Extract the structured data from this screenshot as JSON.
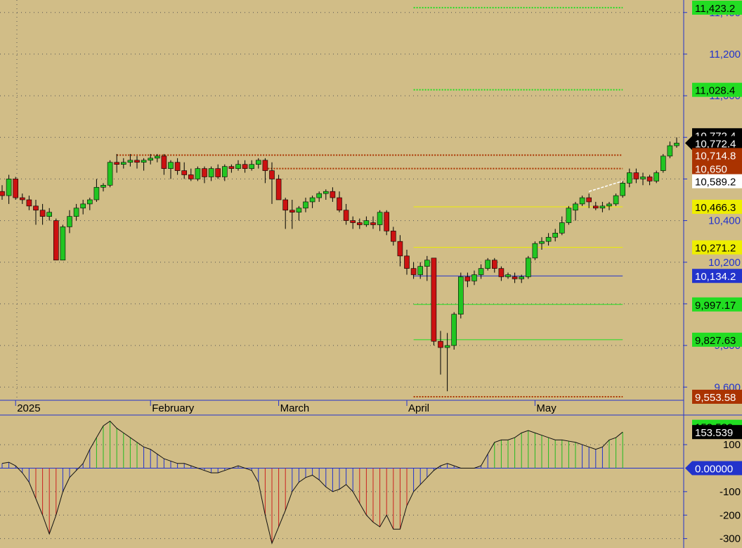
{
  "colors": {
    "background": "#d1bd87",
    "up": "#22c522",
    "down": "#cc1111",
    "grid": "#555555",
    "axis": "#2233cc",
    "axis_text": "#2233cc",
    "osc_line": "#111111",
    "osc_pos": "#22bb22",
    "osc_neg": "#cc2222",
    "osc_mid": "#2233cc"
  },
  "chart_data": [
    {
      "type": "candlestick",
      "name": "price",
      "ylim": [
        9540,
        11460
      ],
      "y_ticks": [
        {
          "value": 9600,
          "label": "9,600"
        },
        {
          "value": 9800,
          "label": "9,800"
        },
        {
          "value": 10000,
          "label": "10,000"
        },
        {
          "value": 10200,
          "label": "10,200"
        },
        {
          "value": 10400,
          "label": "10,400"
        },
        {
          "value": 10600,
          "label": "10,600"
        },
        {
          "value": 10800,
          "label": "10,800"
        },
        {
          "value": 11000,
          "label": "11,000"
        },
        {
          "value": 11200,
          "label": "11,200"
        },
        {
          "value": 11400,
          "label": "11,400"
        }
      ],
      "x_labels": [
        {
          "index": 2,
          "label": "2025"
        },
        {
          "index": 22,
          "label": "February"
        },
        {
          "index": 41,
          "label": "March"
        },
        {
          "index": 60,
          "label": "April"
        },
        {
          "index": 79,
          "label": "May"
        }
      ],
      "candles": [
        [
          10540,
          10570,
          10500,
          10520
        ],
        [
          10520,
          10620,
          10480,
          10600
        ],
        [
          10600,
          10610,
          10500,
          10510
        ],
        [
          10510,
          10530,
          10480,
          10500
        ],
        [
          10500,
          10520,
          10450,
          10470
        ],
        [
          10470,
          10500,
          10380,
          10450
        ],
        [
          10450,
          10480,
          10380,
          10420
        ],
        [
          10420,
          10460,
          10400,
          10440
        ],
        [
          10400,
          10410,
          10210,
          10210
        ],
        [
          10210,
          10380,
          10210,
          10370
        ],
        [
          10370,
          10450,
          10340,
          10420
        ],
        [
          10420,
          10480,
          10400,
          10460
        ],
        [
          10460,
          10500,
          10430,
          10480
        ],
        [
          10480,
          10510,
          10450,
          10500
        ],
        [
          10500,
          10600,
          10490,
          10560
        ],
        [
          10560,
          10580,
          10540,
          10570
        ],
        [
          10570,
          10690,
          10560,
          10680
        ],
        [
          10680,
          10720,
          10630,
          10670
        ],
        [
          10670,
          10700,
          10650,
          10680
        ],
        [
          10680,
          10720,
          10660,
          10690
        ],
        [
          10690,
          10710,
          10650,
          10680
        ],
        [
          10680,
          10700,
          10640,
          10690
        ],
        [
          10690,
          10720,
          10670,
          10700
        ],
        [
          10700,
          10720,
          10680,
          10710
        ],
        [
          10710,
          10720,
          10620,
          10650
        ],
        [
          10650,
          10690,
          10600,
          10680
        ],
        [
          10680,
          10700,
          10620,
          10640
        ],
        [
          10640,
          10680,
          10600,
          10620
        ],
        [
          10620,
          10650,
          10590,
          10600
        ],
        [
          10600,
          10660,
          10590,
          10650
        ],
        [
          10650,
          10660,
          10580,
          10610
        ],
        [
          10610,
          10660,
          10590,
          10650
        ],
        [
          10650,
          10670,
          10600,
          10610
        ],
        [
          10610,
          10670,
          10590,
          10660
        ],
        [
          10660,
          10670,
          10630,
          10650
        ],
        [
          10650,
          10690,
          10640,
          10670
        ],
        [
          10670,
          10690,
          10630,
          10650
        ],
        [
          10650,
          10690,
          10640,
          10670
        ],
        [
          10670,
          10700,
          10650,
          10690
        ],
        [
          10690,
          10700,
          10580,
          10640
        ],
        [
          10640,
          10680,
          10480,
          10600
        ],
        [
          10600,
          10620,
          10500,
          10500
        ],
        [
          10500,
          10510,
          10360,
          10450
        ],
        [
          10450,
          10500,
          10360,
          10440
        ],
        [
          10440,
          10470,
          10400,
          10460
        ],
        [
          10460,
          10510,
          10440,
          10490
        ],
        [
          10490,
          10520,
          10460,
          10510
        ],
        [
          10510,
          10540,
          10490,
          10530
        ],
        [
          10530,
          10550,
          10500,
          10540
        ],
        [
          10540,
          10560,
          10490,
          10510
        ],
        [
          10510,
          10540,
          10440,
          10450
        ],
        [
          10450,
          10480,
          10380,
          10400
        ],
        [
          10400,
          10420,
          10360,
          10390
        ],
        [
          10390,
          10410,
          10360,
          10380
        ],
        [
          10380,
          10420,
          10370,
          10400
        ],
        [
          10390,
          10420,
          10360,
          10380
        ],
        [
          10380,
          10450,
          10350,
          10440
        ],
        [
          10440,
          10450,
          10330,
          10350
        ],
        [
          10350,
          10370,
          10280,
          10300
        ],
        [
          10300,
          10330,
          10180,
          10230
        ],
        [
          10230,
          10260,
          10140,
          10170
        ],
        [
          10170,
          10200,
          10120,
          10140
        ],
        [
          10140,
          10200,
          10120,
          10180
        ],
        [
          10180,
          10230,
          10110,
          10210
        ],
        [
          10220,
          10220,
          9800,
          9820
        ],
        [
          9820,
          9870,
          9660,
          9790
        ],
        [
          9790,
          9860,
          9580,
          9800
        ],
        [
          9800,
          9960,
          9780,
          9950
        ],
        [
          9950,
          10150,
          9930,
          10130
        ],
        [
          10130,
          10150,
          10080,
          10110
        ],
        [
          10110,
          10160,
          10090,
          10140
        ],
        [
          10140,
          10190,
          10120,
          10170
        ],
        [
          10170,
          10220,
          10160,
          10210
        ],
        [
          10210,
          10220,
          10150,
          10170
        ],
        [
          10170,
          10180,
          10110,
          10130
        ],
        [
          10130,
          10150,
          10120,
          10140
        ],
        [
          10130,
          10150,
          10100,
          10120
        ],
        [
          10120,
          10140,
          10100,
          10130
        ],
        [
          10130,
          10230,
          10120,
          10220
        ],
        [
          10220,
          10300,
          10210,
          10290
        ],
        [
          10290,
          10320,
          10260,
          10300
        ],
        [
          10300,
          10340,
          10280,
          10320
        ],
        [
          10320,
          10360,
          10300,
          10340
        ],
        [
          10340,
          10420,
          10330,
          10390
        ],
        [
          10390,
          10470,
          10380,
          10460
        ],
        [
          10450,
          10490,
          10400,
          10480
        ],
        [
          10480,
          10520,
          10470,
          10510
        ],
        [
          10510,
          10530,
          10460,
          10490
        ],
        [
          10470,
          10490,
          10450,
          10460
        ],
        [
          10460,
          10490,
          10440,
          10470
        ],
        [
          10470,
          10490,
          10450,
          10480
        ],
        [
          10480,
          10530,
          10470,
          10520
        ],
        [
          10520,
          10590,
          10510,
          10580
        ],
        [
          10580,
          10650,
          10560,
          10630
        ],
        [
          10630,
          10650,
          10580,
          10600
        ],
        [
          10600,
          10630,
          10570,
          10610
        ],
        [
          10610,
          10620,
          10570,
          10590
        ],
        [
          10590,
          10640,
          10580,
          10630
        ],
        [
          10640,
          10720,
          10630,
          10710
        ],
        [
          10710,
          10780,
          10700,
          10760
        ],
        [
          10760,
          10800,
          10750,
          10772.4
        ]
      ],
      "levels": [
        {
          "value": 11423.2,
          "color": "#22dd22",
          "style": "dotted",
          "from": 61,
          "to": 92
        },
        {
          "value": 11028.4,
          "color": "#22dd22",
          "style": "dotted",
          "from": 61,
          "to": 92
        },
        {
          "value": 10714.8,
          "color": "#aa3300",
          "style": "dotted",
          "from": 17,
          "to": 92
        },
        {
          "value": 10650,
          "color": "#aa3300",
          "style": "dotted",
          "from": 39,
          "to": 92
        },
        {
          "value": 10466.3,
          "color": "#eeee00",
          "style": "solid",
          "from": 61,
          "to": 92
        },
        {
          "value": 10271.2,
          "color": "#eeee00",
          "style": "solid",
          "from": 61,
          "to": 92
        },
        {
          "value": 10134.2,
          "color": "#2233cc",
          "style": "solid",
          "from": 61,
          "to": 92
        },
        {
          "value": 9997.17,
          "color": "#22dd22",
          "style": "solid",
          "from": 61,
          "to": 92
        },
        {
          "value": 9827.63,
          "color": "#22dd22",
          "style": "solid",
          "from": 61,
          "to": 92
        },
        {
          "value": 9553.58,
          "color": "#aa3300",
          "style": "dotted",
          "from": 61,
          "to": 92
        }
      ],
      "trendline": {
        "from": [
          87,
          10540
        ],
        "to": [
          92,
          10590
        ],
        "color": "#ffffff"
      },
      "price_labels": [
        {
          "value": 11423.2,
          "text": "11,423.2",
          "bg": "#22dd22",
          "fg": "#000000"
        },
        {
          "value": 11028.4,
          "text": "11,028.4",
          "bg": "#22dd22",
          "fg": "#000000"
        },
        {
          "value": 10810,
          "text": "10,772.4",
          "bg": "#000000",
          "fg": "#ffffff"
        },
        {
          "value": 10772.4,
          "text": "10,772.4",
          "bg": "#000000",
          "fg": "#ffffff",
          "pointer": true
        },
        {
          "value": 10714.8,
          "text": "10,714.8",
          "bg": "#aa3300",
          "fg": "#ffffff"
        },
        {
          "value": 10650,
          "text": "10,650",
          "bg": "#aa3300",
          "fg": "#ffffff"
        },
        {
          "value": 10589.2,
          "text": "10,589.2",
          "bg": "#ffffff",
          "fg": "#000000"
        },
        {
          "value": 10466.3,
          "text": "10,466.3",
          "bg": "#eeee00",
          "fg": "#000000"
        },
        {
          "value": 10271.2,
          "text": "10,271.2",
          "bg": "#eeee00",
          "fg": "#000000"
        },
        {
          "value": 10134.2,
          "text": "10,134.2",
          "bg": "#2233cc",
          "fg": "#ffffff"
        },
        {
          "value": 9997.17,
          "text": "9,997.17",
          "bg": "#22dd22",
          "fg": "#000000"
        },
        {
          "value": 9827.63,
          "text": "9,827.63",
          "bg": "#22dd22",
          "fg": "#000000"
        },
        {
          "value": 9553.58,
          "text": "9,553.58",
          "bg": "#aa3300",
          "fg": "#ffffff"
        }
      ]
    },
    {
      "type": "histogram",
      "name": "oscillator",
      "ylim": [
        -340,
        220
      ],
      "y_ticks": [
        {
          "value": 100,
          "label": "100"
        },
        {
          "value": -100,
          "label": "-100"
        },
        {
          "value": -200,
          "label": "-200"
        },
        {
          "value": -300,
          "label": "-300"
        }
      ],
      "values": [
        20,
        25,
        10,
        -20,
        -60,
        -130,
        -200,
        -280,
        -200,
        -100,
        -40,
        -10,
        20,
        80,
        130,
        180,
        200,
        170,
        150,
        130,
        110,
        90,
        80,
        60,
        40,
        30,
        20,
        20,
        10,
        0,
        -10,
        -20,
        -20,
        -10,
        0,
        10,
        0,
        -10,
        -60,
        -200,
        -320,
        -250,
        -180,
        -100,
        -60,
        -40,
        -30,
        -50,
        -80,
        -100,
        -90,
        -70,
        -100,
        -150,
        -200,
        -230,
        -250,
        -200,
        -260,
        -260,
        -160,
        -100,
        -70,
        -40,
        -10,
        10,
        20,
        10,
        0,
        0,
        0,
        10,
        60,
        110,
        120,
        120,
        130,
        150,
        160,
        150,
        140,
        130,
        120,
        120,
        115,
        110,
        100,
        90,
        80,
        90,
        120,
        130,
        153.539
      ],
      "price_labels": [
        {
          "value": 176,
          "text": "153.539",
          "bg": "#22dd22",
          "fg": "#000000"
        },
        {
          "value": 153.539,
          "text": "153.539",
          "bg": "#000000",
          "fg": "#ffffff"
        },
        {
          "value": 0,
          "text": "0.00000",
          "bg": "#2233cc",
          "fg": "#ffffff",
          "pointer": true
        }
      ]
    }
  ]
}
